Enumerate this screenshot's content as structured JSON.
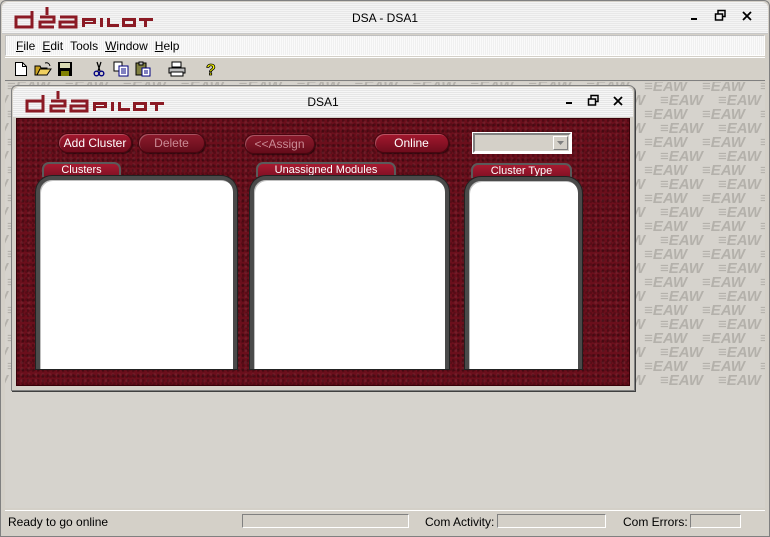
{
  "app": {
    "title": "DSA - DSA1",
    "logo_text": "dsa PILOT",
    "window_controls": [
      "minimize-icon",
      "restore-icon",
      "close-icon"
    ]
  },
  "menubar": {
    "items": [
      {
        "label": "File",
        "underline": "F"
      },
      {
        "label": "Edit",
        "underline": "E"
      },
      {
        "label": "Tools",
        "underline": ""
      },
      {
        "label": "Window",
        "underline": "W"
      },
      {
        "label": "Help",
        "underline": "H"
      }
    ]
  },
  "toolbar": {
    "buttons": [
      "new-icon",
      "open-icon",
      "save-icon",
      "cut-icon",
      "copy-icon",
      "paste-icon",
      "print-icon",
      "help-icon"
    ]
  },
  "background": {
    "watermark": "EAW"
  },
  "child_window": {
    "title": "DSA1",
    "logo_text": "dsa PILOT",
    "buttons": {
      "add_cluster": "Add Cluster",
      "delete": "Delete",
      "assign": "<<Assign",
      "online": "Online"
    },
    "combo": {
      "value": ""
    },
    "lists": {
      "clusters": {
        "label": "Clusters",
        "items": []
      },
      "unassigned": {
        "label": "Unassigned Modules",
        "items": []
      },
      "cluster_type": {
        "label": "Cluster Type",
        "items": []
      }
    }
  },
  "statusbar": {
    "message": "Ready to go online",
    "com_activity_label": "Com Activity:",
    "com_errors_label": "Com Errors:",
    "com_activity_value": "",
    "com_errors_value": ""
  },
  "colors": {
    "accent": "#6b0f1c",
    "button": "#8a1226",
    "logo": "#8b1a24"
  }
}
